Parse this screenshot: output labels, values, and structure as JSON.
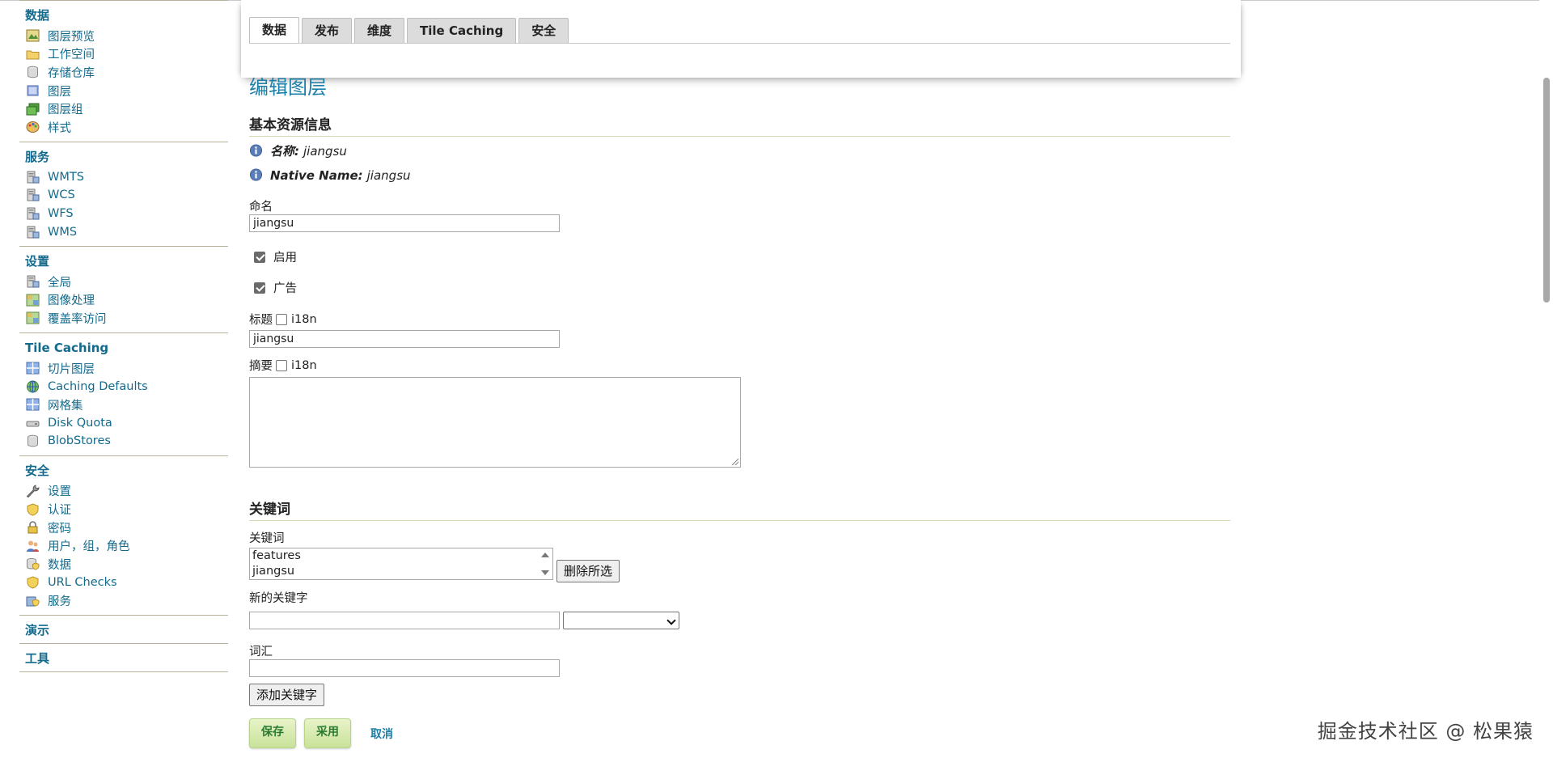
{
  "sidebar": {
    "sections": [
      {
        "title": "数据",
        "items": [
          {
            "label": "图层预览",
            "icon": "layer-preview-icon"
          },
          {
            "label": "工作空间",
            "icon": "folder-icon"
          },
          {
            "label": "存储仓库",
            "icon": "database-icon"
          },
          {
            "label": "图层",
            "icon": "layer-icon"
          },
          {
            "label": "图层组",
            "icon": "layer-group-icon"
          },
          {
            "label": "样式",
            "icon": "palette-icon"
          }
        ]
      },
      {
        "title": "服务",
        "items": [
          {
            "label": "WMTS",
            "icon": "server-icon"
          },
          {
            "label": "WCS",
            "icon": "server-icon"
          },
          {
            "label": "WFS",
            "icon": "server-icon"
          },
          {
            "label": "WMS",
            "icon": "server-icon"
          }
        ]
      },
      {
        "title": "设置",
        "items": [
          {
            "label": "全局",
            "icon": "server-icon"
          },
          {
            "label": "图像处理",
            "icon": "map-icon"
          },
          {
            "label": "覆盖率访问",
            "icon": "map-icon"
          }
        ]
      },
      {
        "title": "Tile Caching",
        "items": [
          {
            "label": "切片图层",
            "icon": "grid-icon"
          },
          {
            "label": "Caching Defaults",
            "icon": "globe-icon"
          },
          {
            "label": "网格集",
            "icon": "grid-icon"
          },
          {
            "label": "Disk Quota",
            "icon": "disk-icon"
          },
          {
            "label": "BlobStores",
            "icon": "database-icon"
          }
        ]
      },
      {
        "title": "安全",
        "items": [
          {
            "label": "设置",
            "icon": "wrench-icon"
          },
          {
            "label": "认证",
            "icon": "shield-icon"
          },
          {
            "label": "密码",
            "icon": "lock-icon"
          },
          {
            "label": "用户，组，角色",
            "icon": "users-icon"
          },
          {
            "label": "数据",
            "icon": "data-security-icon"
          },
          {
            "label": "URL Checks",
            "icon": "shield-icon"
          },
          {
            "label": "服务",
            "icon": "service-security-icon"
          }
        ]
      },
      {
        "title": "演示",
        "items": []
      },
      {
        "title": "工具",
        "items": []
      }
    ]
  },
  "tabs": [
    "数据",
    "发布",
    "维度",
    "Tile Caching",
    "安全"
  ],
  "active_tab": 0,
  "page_title": "编辑图层",
  "basic": {
    "heading": "基本资源信息",
    "name_key": "名称:",
    "name_value": "jiangsu",
    "native_key": "Native Name:",
    "native_value": "jiangsu",
    "naming_label": "命名",
    "naming_value": "jiangsu",
    "enabled_label": "启用",
    "advertised_label": "广告",
    "title_label": "标题",
    "i18n_label": "i18n",
    "title_value": "jiangsu",
    "abstract_label": "摘要",
    "abstract_i18n_label": "i18n"
  },
  "keywords": {
    "heading": "关键词",
    "list_label": "关键词",
    "items": [
      "features",
      "jiangsu"
    ],
    "remove_button": "删除所选",
    "new_keyword_label": "新的关键字",
    "vocabulary_label": "词汇",
    "add_button": "添加关键字"
  },
  "actions": {
    "save": "保存",
    "apply": "采用",
    "cancel": "取消"
  },
  "watermark": "掘金技术社区 @ 松果猿",
  "colors": {
    "link": "#136a8c",
    "title": "#1c7fa8",
    "green_button": "#c9e29a"
  }
}
